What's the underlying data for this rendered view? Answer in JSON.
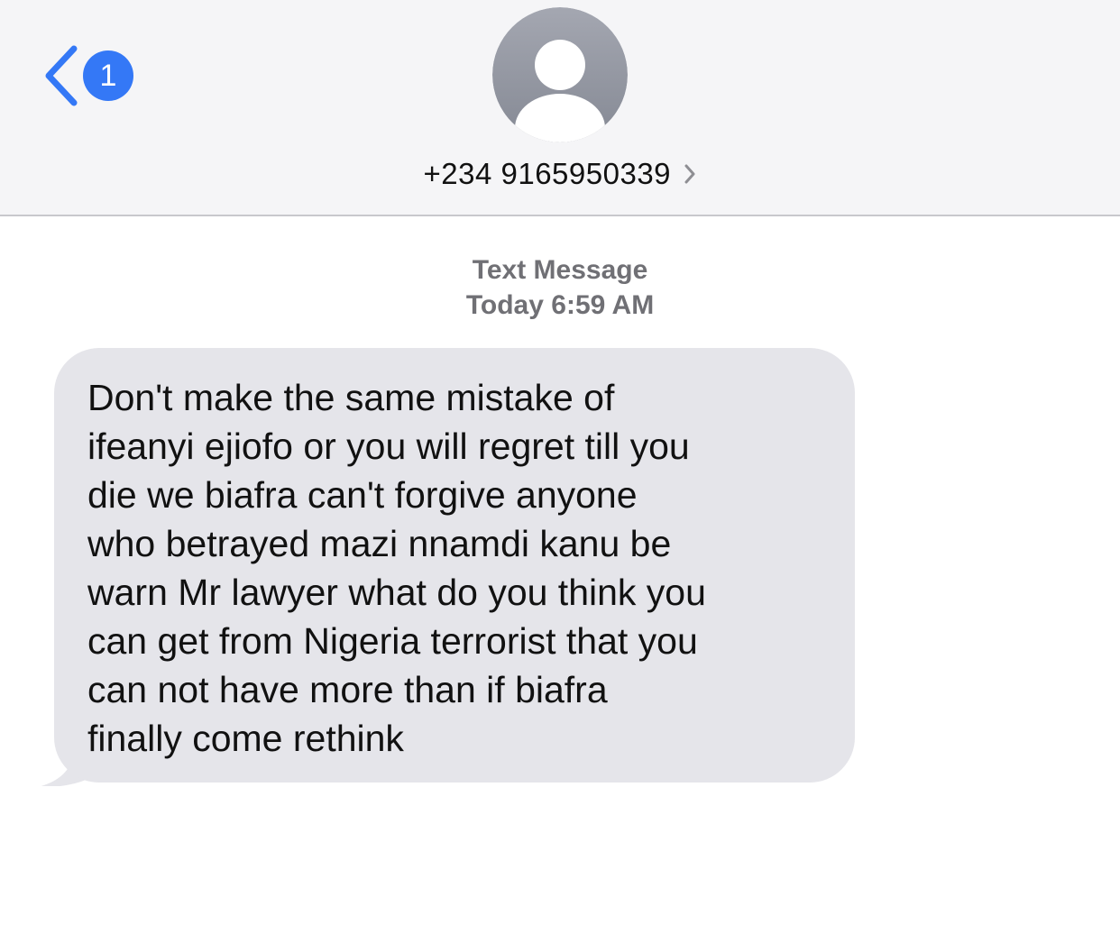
{
  "header": {
    "back_badge_count": "1",
    "contact_number": "+234 9165950339",
    "accent_color": "#3478f6"
  },
  "thread": {
    "service_label": "Text Message",
    "timestamp": "Today 6:59 AM"
  },
  "messages": [
    {
      "direction": "incoming",
      "text": "Don't make the same mistake of\nifeanyi ejiofo or you will regret till you\ndie we biafra can't forgive anyone\nwho betrayed mazi nnamdi kanu be\nwarn Mr lawyer what do you think you\ncan get from Nigeria terrorist that you\ncan not have more than if biafra\nfinally come rethink"
    }
  ],
  "icons": {
    "back": "chevron-left-icon",
    "avatar": "person-placeholder-icon",
    "contact_details": "chevron-right-icon"
  }
}
